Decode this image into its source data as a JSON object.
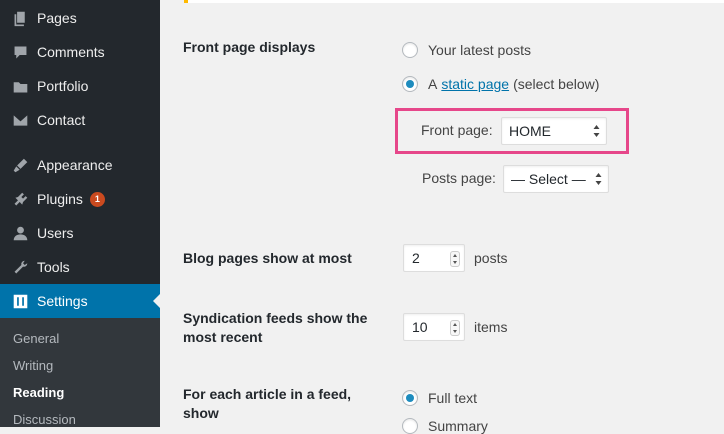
{
  "sidebar": {
    "items": [
      {
        "label": "Pages",
        "icon": "pages-icon"
      },
      {
        "label": "Comments",
        "icon": "comments-icon"
      },
      {
        "label": "Portfolio",
        "icon": "portfolio-icon"
      },
      {
        "label": "Contact",
        "icon": "contact-icon"
      },
      {
        "label": "Appearance",
        "icon": "appearance-icon"
      },
      {
        "label": "Plugins",
        "icon": "plugins-icon",
        "badge": "1"
      },
      {
        "label": "Users",
        "icon": "users-icon"
      },
      {
        "label": "Tools",
        "icon": "tools-icon"
      },
      {
        "label": "Settings",
        "icon": "settings-icon",
        "current": true
      }
    ],
    "submenu": [
      "General",
      "Writing",
      "Reading",
      "Discussion"
    ],
    "active_submenu": "Reading"
  },
  "settings": {
    "front_page_displays": {
      "label": "Front page displays",
      "option_latest": "Your latest posts",
      "option_static_prefix": "A",
      "option_static_link": "static page",
      "option_static_suffix": "(select below)",
      "selected": "static page"
    },
    "front_page": {
      "label": "Front page:",
      "value": "HOME"
    },
    "posts_page": {
      "label": "Posts page:",
      "value": "— Select —"
    },
    "blog_pages": {
      "label": "Blog pages show at most",
      "value": "2",
      "suffix": "posts"
    },
    "syndication": {
      "label_line1": "Syndication feeds show the",
      "label_line2": "most recent",
      "value": "10",
      "suffix": "items"
    },
    "feed_article": {
      "label_line1": "For each article in a feed,",
      "label_line2": "show",
      "option_full": "Full text",
      "option_summary": "Summary",
      "selected": "Full text"
    }
  },
  "colors": {
    "sidebar_bg": "#23282d",
    "accent": "#0073aa",
    "highlight_border": "#e6478a",
    "badge": "#ca4a1f"
  }
}
